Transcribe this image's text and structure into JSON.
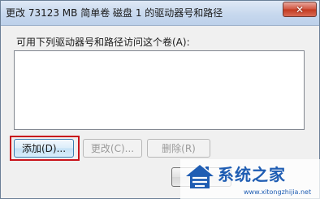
{
  "window": {
    "title": "更改 73123 MB 简单卷 磁盘 1 的驱动器号和路径",
    "close_glyph": "✕"
  },
  "main": {
    "prompt": "可用下列驱动器号和路径访问这个卷(A):",
    "list_items": []
  },
  "buttons": {
    "add_label": "添加(D)...",
    "change_label": "更改(C)...",
    "delete_label": "删除(R)",
    "ok_label": ""
  },
  "watermark": {
    "text": "系统之家",
    "url": "www.xitongzhijia.net",
    "logo_icon": "house-logo-icon"
  },
  "colors": {
    "highlight": "#c8141b",
    "watermark": "#1f5db3"
  }
}
